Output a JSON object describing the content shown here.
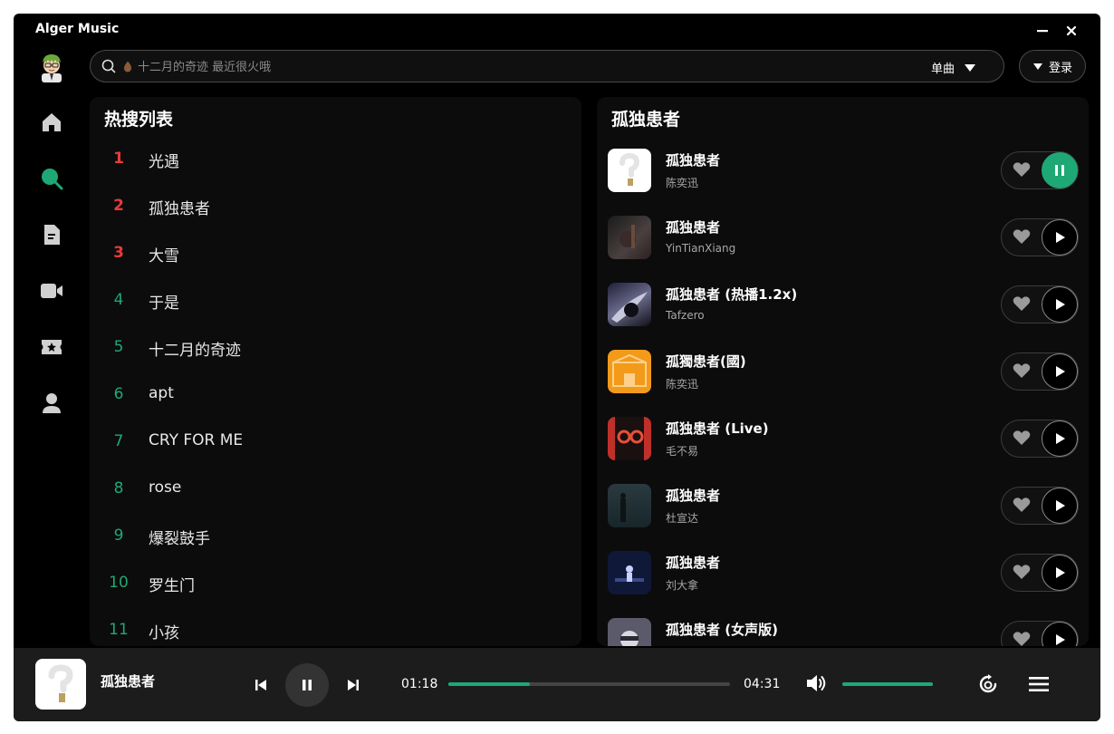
{
  "app": {
    "title": "Alger Music"
  },
  "search": {
    "placeholder": "十二月的奇迹 最近很火哦",
    "type_label": "单曲",
    "login_label": "登录"
  },
  "nav": {
    "items": [
      {
        "name": "home",
        "icon": "home-icon"
      },
      {
        "name": "search",
        "icon": "search-icon",
        "active": true
      },
      {
        "name": "playlist",
        "icon": "document-icon"
      },
      {
        "name": "mv",
        "icon": "video-icon"
      },
      {
        "name": "ranking",
        "icon": "ticket-icon"
      },
      {
        "name": "user",
        "icon": "user-icon"
      }
    ]
  },
  "hot": {
    "title": "热搜列表",
    "items": [
      {
        "rank": "1",
        "name": "光遇"
      },
      {
        "rank": "2",
        "name": "孤独患者"
      },
      {
        "rank": "3",
        "name": "大雪"
      },
      {
        "rank": "4",
        "name": "于是"
      },
      {
        "rank": "5",
        "name": "十二月的奇迹"
      },
      {
        "rank": "6",
        "name": "apt"
      },
      {
        "rank": "7",
        "name": "CRY FOR ME"
      },
      {
        "rank": "8",
        "name": "rose"
      },
      {
        "rank": "9",
        "name": "爆裂鼓手"
      },
      {
        "rank": "10",
        "name": "罗生门"
      },
      {
        "rank": "11",
        "name": "小孩"
      }
    ]
  },
  "results": {
    "title": "孤独患者",
    "songs": [
      {
        "title": "孤独患者",
        "artist": "陈奕迅",
        "playing": true
      },
      {
        "title": "孤独患者",
        "artist": "YinTianXiang",
        "playing": false
      },
      {
        "title": "孤独患者 (热播1.2x)",
        "artist": "Tafzero",
        "playing": false
      },
      {
        "title": "孤獨患者(國)",
        "artist": "陈奕迅",
        "playing": false
      },
      {
        "title": "孤独患者 (Live)",
        "artist": "毛不易",
        "playing": false
      },
      {
        "title": "孤独患者",
        "artist": "杜宣达",
        "playing": false
      },
      {
        "title": "孤独患者",
        "artist": "刘大拿",
        "playing": false
      },
      {
        "title": "孤独患者 (女声版)",
        "artist": "",
        "playing": false
      }
    ]
  },
  "player": {
    "title": "孤独患者",
    "current_time": "01:18",
    "total_time": "04:31",
    "progress_fraction": 0.288,
    "volume_fraction": 1.0
  },
  "colors": {
    "accent": "#1ea876",
    "hot_top": "#e83b3b",
    "background": "#000000",
    "panel": "#0c0c0c",
    "player_bar": "#1c1c1c"
  }
}
